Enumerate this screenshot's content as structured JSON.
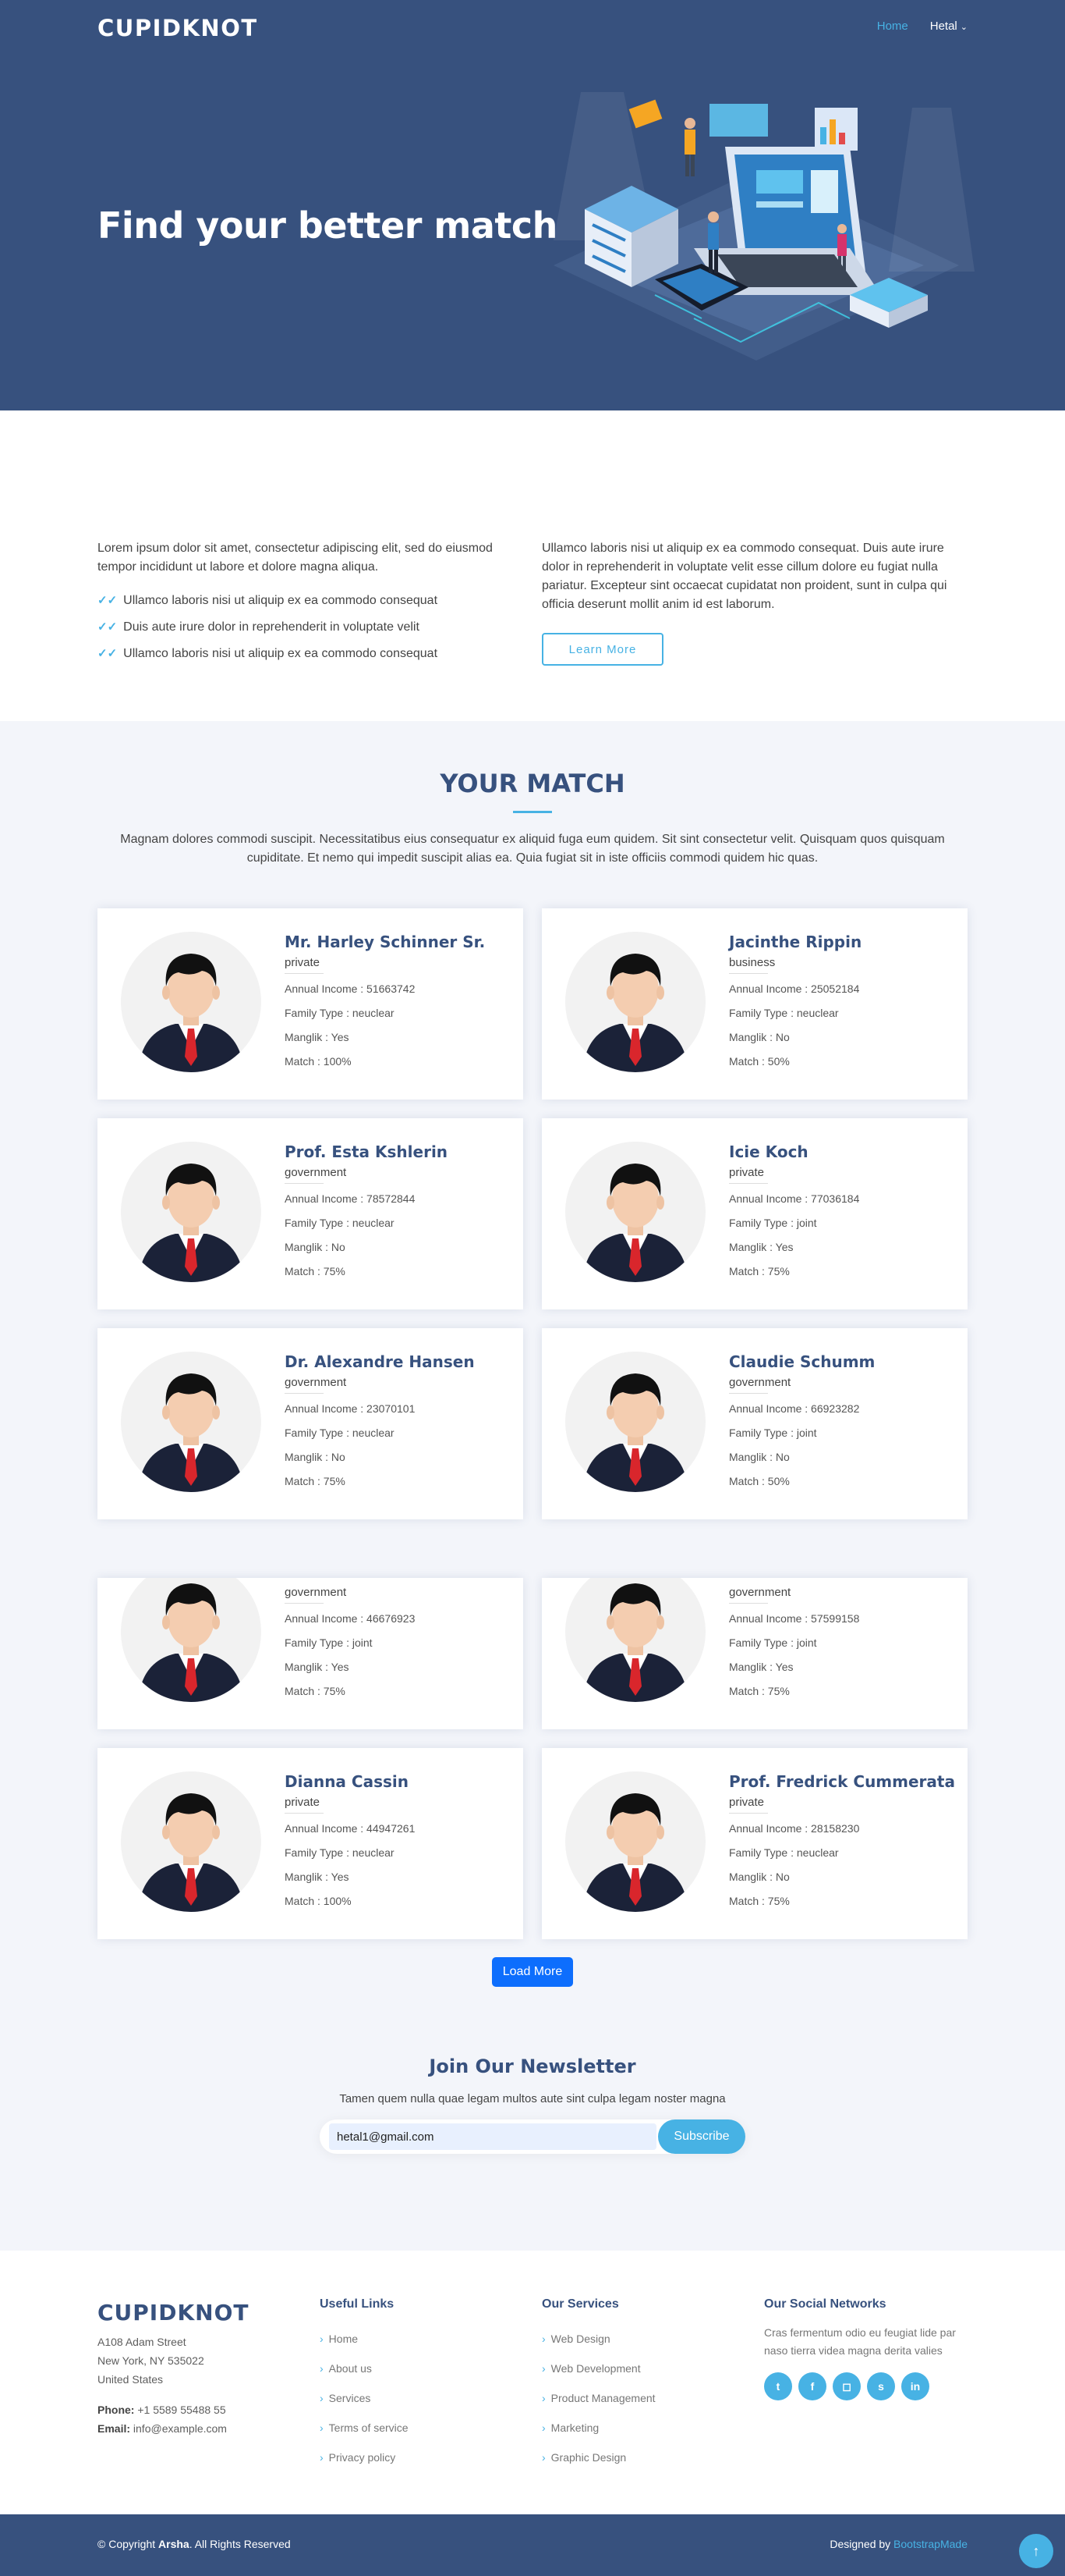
{
  "header": {
    "logo": "CUPIDKNOT",
    "nav": [
      {
        "label": "Home",
        "active": true
      },
      {
        "label": "Hetal",
        "active": false
      }
    ]
  },
  "hero": {
    "title": "Find your better match"
  },
  "about": {
    "intro": "Lorem ipsum dolor sit amet, consectetur adipiscing elit, sed do eiusmod tempor incididunt ut labore et dolore magna aliqua.",
    "bullets": [
      "Ullamco laboris nisi ut aliquip ex ea commodo consequat",
      "Duis aute irure dolor in reprehenderit in voluptate velit",
      "Ullamco laboris nisi ut aliquip ex ea commodo consequat"
    ],
    "right_text": "Ullamco laboris nisi ut aliquip ex ea commodo consequat. Duis aute irure dolor in reprehenderit in voluptate velit esse cillum dolore eu fugiat nulla pariatur. Excepteur sint occaecat cupidatat non proident, sunt in culpa qui officia deserunt mollit anim id est laborum.",
    "button": "Learn More"
  },
  "match": {
    "title": "YOUR MATCH",
    "description": "Magnam dolores commodi suscipit. Necessitatibus eius consequatur ex aliquid fuga eum quidem. Sit sint consectetur velit. Quisquam quos quisquam cupiditate. Et nemo qui impedit suscipit alias ea. Quia fugiat sit in iste officiis commodi quidem hic quas.",
    "profiles": [
      {
        "name": "Mr. Harley Schinner Sr.",
        "type": "private",
        "income": "Annual Income : 51663742",
        "family": "Family Type : neuclear",
        "manglik": "Manglik : Yes",
        "match": "Match : 100%"
      },
      {
        "name": "Jacinthe Rippin",
        "type": "business",
        "income": "Annual Income : 25052184",
        "family": "Family Type : neuclear",
        "manglik": "Manglik : No",
        "match": "Match : 50%"
      },
      {
        "name": "Prof. Esta Kshlerin",
        "type": "government",
        "income": "Annual Income : 78572844",
        "family": "Family Type : neuclear",
        "manglik": "Manglik : No",
        "match": "Match : 75%"
      },
      {
        "name": "Icie Koch",
        "type": "private",
        "income": "Annual Income : 77036184",
        "family": "Family Type : joint",
        "manglik": "Manglik : Yes",
        "match": "Match : 75%"
      },
      {
        "name": "Dr. Alexandre Hansen",
        "type": "government",
        "income": "Annual Income : 23070101",
        "family": "Family Type : neuclear",
        "manglik": "Manglik : No",
        "match": "Match : 75%"
      },
      {
        "name": "Claudie Schumm",
        "type": "government",
        "income": "Annual Income : 66923282",
        "family": "Family Type : joint",
        "manglik": "Manglik : No",
        "match": "Match : 50%"
      },
      {
        "name": "",
        "type": "government",
        "income": "Annual Income : 46676923",
        "family": "Family Type : joint",
        "manglik": "Manglik : Yes",
        "match": "Match : 75%"
      },
      {
        "name": "",
        "type": "government",
        "income": "Annual Income : 57599158",
        "family": "Family Type : joint",
        "manglik": "Manglik : Yes",
        "match": "Match : 75%"
      },
      {
        "name": "Dianna Cassin",
        "type": "private",
        "income": "Annual Income : 44947261",
        "family": "Family Type : neuclear",
        "manglik": "Manglik : Yes",
        "match": "Match : 100%"
      },
      {
        "name": "Prof. Fredrick Cummerata",
        "type": "private",
        "income": "Annual Income : 28158230",
        "family": "Family Type : neuclear",
        "manglik": "Manglik : No",
        "match": "Match : 75%"
      }
    ],
    "load_more": "Load More"
  },
  "newsletter": {
    "title": "Join Our Newsletter",
    "description": "Tamen quem nulla quae legam multos aute sint culpa legam noster magna",
    "email_value": "hetal1@gmail.com",
    "button": "Subscribe"
  },
  "footer": {
    "logo": "CUPIDKNOT",
    "address": [
      "A108 Adam Street",
      "New York, NY 535022",
      "United States"
    ],
    "phone_label": "Phone:",
    "phone": "+1 5589 55488 55",
    "email_label": "Email:",
    "email": "info@example.com",
    "useful_links": {
      "title": "Useful Links",
      "items": [
        "Home",
        "About us",
        "Services",
        "Terms of service",
        "Privacy policy"
      ]
    },
    "services": {
      "title": "Our Services",
      "items": [
        "Web Design",
        "Web Development",
        "Product Management",
        "Marketing",
        "Graphic Design"
      ]
    },
    "social": {
      "title": "Our Social Networks",
      "text": "Cras fermentum odio eu feugiat lide par naso tierra videa magna derita valies",
      "icons": [
        "twitter-icon",
        "facebook-icon",
        "instagram-icon",
        "skype-icon",
        "linkedin-icon"
      ]
    },
    "copyright_prefix": "© Copyright ",
    "copyright_brand": "Arsha",
    "copyright_suffix": ". All Rights Reserved",
    "credits_prefix": "Designed by ",
    "credits_link": "BootstrapMade"
  },
  "colors": {
    "primary": "#37517e",
    "accent": "#47b2e4",
    "section_bg": "#f3f5fa",
    "load_button": "#0d6efd"
  }
}
